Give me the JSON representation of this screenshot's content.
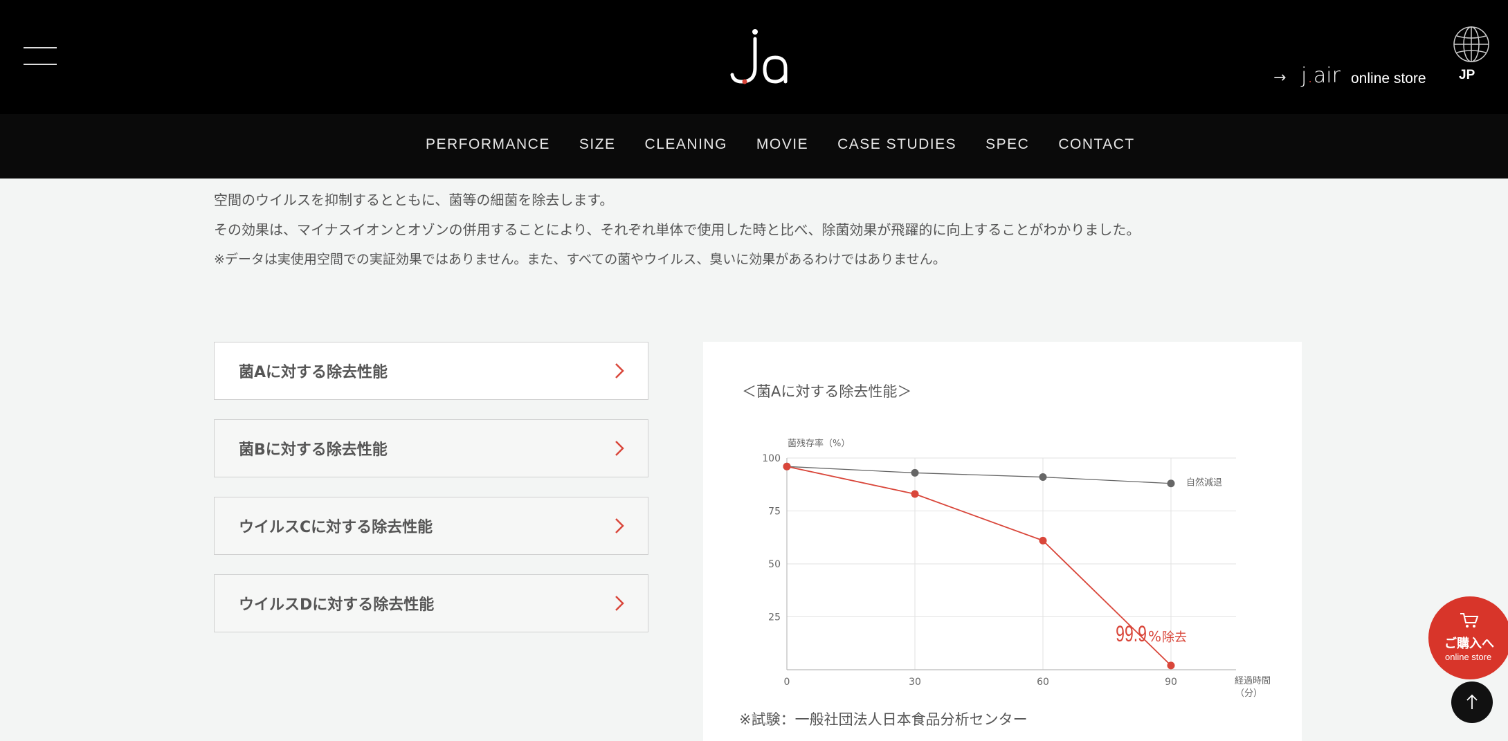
{
  "header": {
    "store_arrow": "→",
    "store_brand_j": "j",
    "store_brand_dot": ".",
    "store_brand_air": "air",
    "store_label": "online store",
    "lang": "JP"
  },
  "nav": {
    "items": [
      "PERFORMANCE",
      "SIZE",
      "CLEANING",
      "MOVIE",
      "CASE STUDIES",
      "SPEC",
      "CONTACT"
    ]
  },
  "intro": {
    "line1": "空間のウイルスを抑制するとともに、菌等の細菌を除去します。",
    "line2": "その効果は、マイナスイオンとオゾンの併用することにより、それぞれ単体で使用した時と比べ、除菌効果が飛躍的に向上することがわかりました。",
    "note": "※データは実使用空間での実証効果ではありません。また、すべての菌やウイルス、臭いに効果があるわけではありません。"
  },
  "tabs": [
    {
      "label": "菌Aに対する除去性能",
      "active": true
    },
    {
      "label": "菌Bに対する除去性能",
      "active": false
    },
    {
      "label": "ウイルスCに対する除去性能",
      "active": false
    },
    {
      "label": "ウイルスDに対する除去性能",
      "active": false
    }
  ],
  "panel": {
    "title": "＜菌Aに対する除去性能＞",
    "footnote": "※試験：一般社団法人日本食品分析センター"
  },
  "chart_data": {
    "type": "line",
    "ylabel": "菌残存率（%）",
    "xlabel": "経過時間（分）",
    "x": [
      0,
      30,
      60,
      90
    ],
    "ylim": [
      0,
      100
    ],
    "yticks": [
      100,
      75,
      50,
      25
    ],
    "xticks": [
      0,
      30,
      60,
      90
    ],
    "series": [
      {
        "name": "自然減退",
        "color": "#666666",
        "values": [
          96,
          93,
          91,
          88
        ]
      },
      {
        "color": "#d9463a",
        "values": [
          96,
          83,
          61,
          2
        ]
      }
    ],
    "annotation": {
      "value": "99.9",
      "unit": "%",
      "label": "除去",
      "color": "#d9463a"
    },
    "grid": true
  },
  "floating": {
    "buy_line1": "ご購入へ",
    "buy_line2": "online store",
    "buy_color": "#d8352a"
  }
}
